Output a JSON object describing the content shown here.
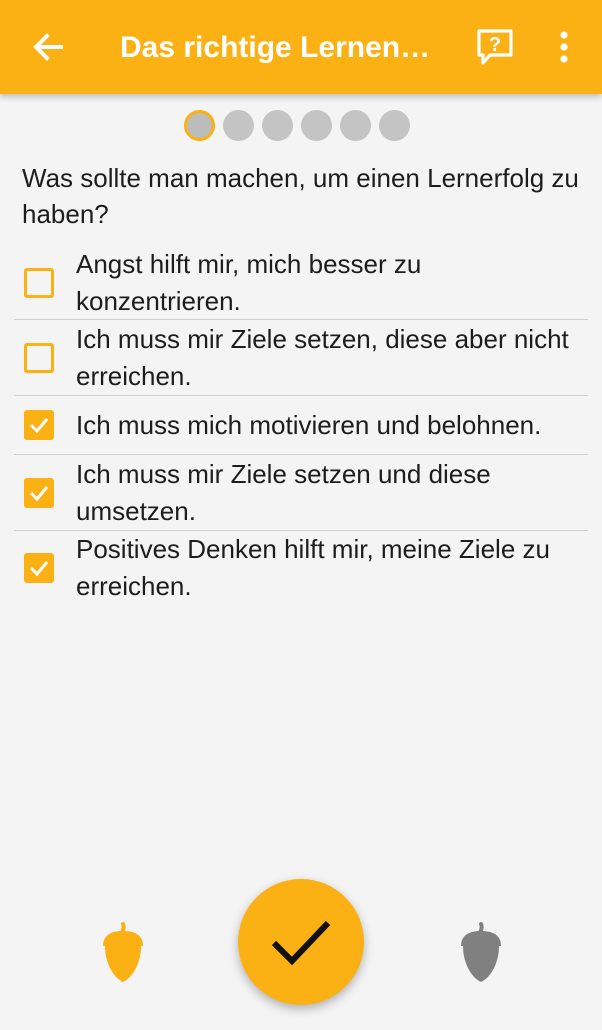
{
  "app_bar": {
    "title": "Das richtige Lernen…",
    "back_icon": "arrow-left-icon",
    "feedback_icon": "feedback-question-icon",
    "menu_icon": "more-vert-icon"
  },
  "progress": {
    "total_steps": 6,
    "current_step": 1
  },
  "question": "Was sollte man machen, um einen Lernerfolg zu haben?",
  "answers": [
    {
      "label": "Angst hilft mir, mich besser zu konzentrieren.",
      "checked": false
    },
    {
      "label": "Ich muss mir Ziele setzen, diese aber nicht erreichen.",
      "checked": false
    },
    {
      "label": "Ich muss mich motivieren und belohnen.",
      "checked": true
    },
    {
      "label": "Ich muss mir Ziele setzen und diese umsetzen.",
      "checked": true
    },
    {
      "label": "Positives Denken hilft mir, meine Ziele zu erreichen.",
      "checked": true
    }
  ],
  "bottom_bar": {
    "left_icon": "acorn-icon",
    "left_color": "#fbb113",
    "right_icon": "acorn-icon",
    "right_color": "#808080",
    "submit_icon": "check-icon"
  },
  "colors": {
    "accent": "#fbb113",
    "background": "#f4f4f4",
    "text": "#1d1d1d",
    "inactive_dot": "#c4c4c4"
  }
}
